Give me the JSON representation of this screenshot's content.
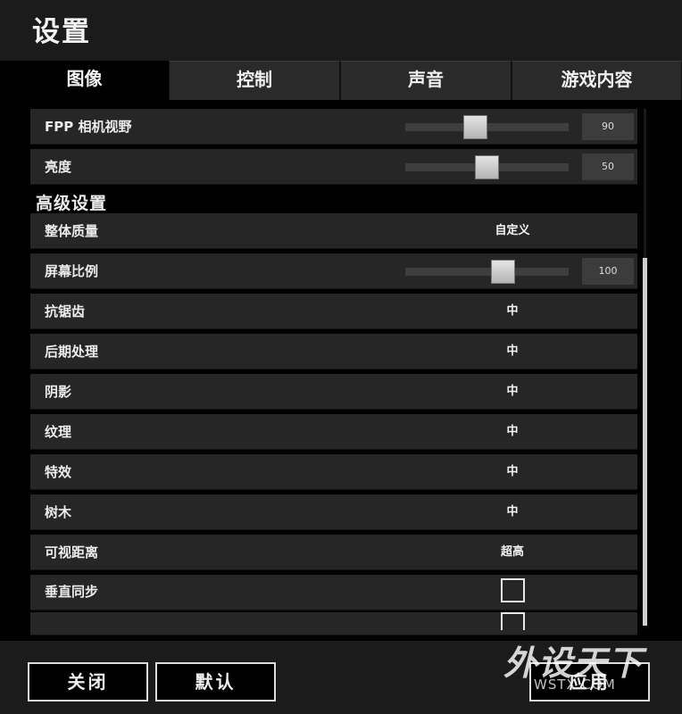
{
  "title": "设置",
  "tabs": [
    {
      "label": "图像",
      "active": true
    },
    {
      "label": "控制",
      "active": false
    },
    {
      "label": "声音",
      "active": false
    },
    {
      "label": "游戏内容",
      "active": false
    }
  ],
  "graphics": {
    "fov": {
      "label": "FPP 相机视野",
      "value": "90",
      "level": 0.43
    },
    "brightness": {
      "label": "亮度",
      "value": "50",
      "level": 0.5
    },
    "advanced_heading": "高级设置",
    "overall_quality": {
      "label": "整体质量",
      "value": "自定义"
    },
    "screen_scale": {
      "label": "屏幕比例",
      "value": "100",
      "level": 0.6
    },
    "anti_aliasing": {
      "label": "抗锯齿",
      "value": "中"
    },
    "post_processing": {
      "label": "后期处理",
      "value": "中"
    },
    "shadows": {
      "label": "阴影",
      "value": "中"
    },
    "textures": {
      "label": "纹理",
      "value": "中"
    },
    "effects": {
      "label": "特效",
      "value": "中"
    },
    "foliage": {
      "label": "树木",
      "value": "中"
    },
    "view_distance": {
      "label": "可视距离",
      "value": "超高"
    },
    "vsync": {
      "label": "垂直同步",
      "checked": false
    }
  },
  "footer": {
    "close_label": "关闭",
    "default_label": "默认",
    "apply_label": "应用"
  },
  "watermark": {
    "main": "外设天下",
    "sub": "WSTX.COM"
  }
}
